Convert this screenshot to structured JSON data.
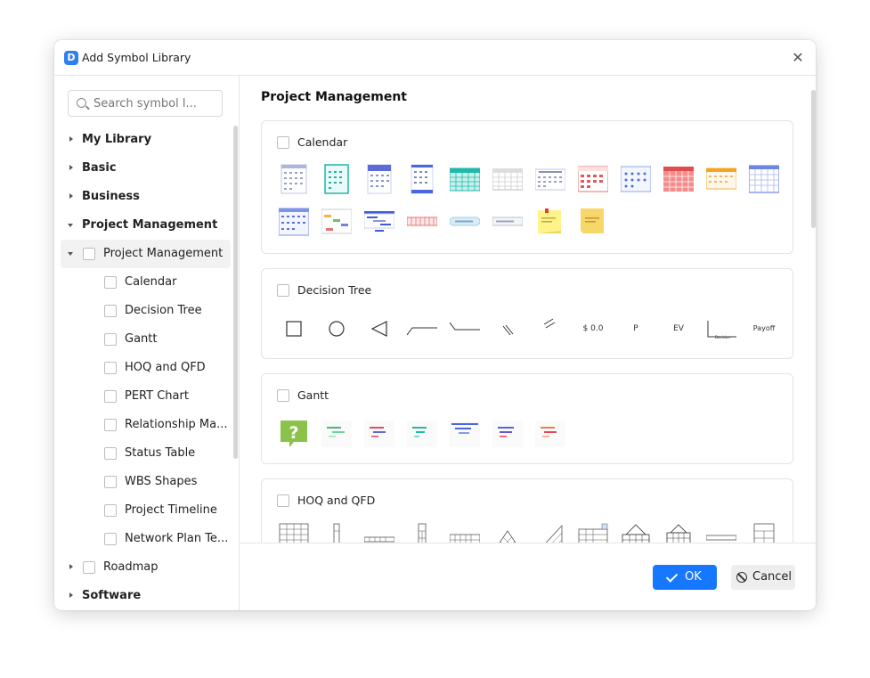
{
  "window": {
    "title": "Add Symbol Library",
    "app_icon": "app-logo-icon",
    "close_icon": "close-icon"
  },
  "search": {
    "placeholder": "Search symbol l..."
  },
  "tree": {
    "top_items": [
      {
        "label": "My Library",
        "expanded": false
      },
      {
        "label": "Basic",
        "expanded": false
      },
      {
        "label": "Business",
        "expanded": false
      },
      {
        "label": "Project Management",
        "expanded": true
      }
    ],
    "group": {
      "label": "Project Management",
      "expanded": true,
      "checked": false
    },
    "children": [
      {
        "label": "Calendar",
        "checked": false
      },
      {
        "label": "Decision Tree",
        "checked": false
      },
      {
        "label": "Gantt",
        "checked": false
      },
      {
        "label": "HOQ and QFD",
        "checked": false
      },
      {
        "label": "PERT Chart",
        "checked": false
      },
      {
        "label": "Relationship Ma...",
        "checked": false
      },
      {
        "label": "Status Table",
        "checked": false
      },
      {
        "label": "WBS Shapes",
        "checked": false
      },
      {
        "label": "Project Timeline",
        "checked": false
      },
      {
        "label": "Network Plan Te...",
        "checked": false
      }
    ],
    "roadmap": {
      "label": "Roadmap",
      "expanded": false,
      "checked": false
    },
    "software": {
      "label": "Software",
      "expanded": false
    }
  },
  "main": {
    "section_title": "Project Management",
    "cards": [
      {
        "title": "Calendar",
        "checked": false
      },
      {
        "title": "Decision Tree",
        "checked": false,
        "symbol_texts": [
          "$ 0.0",
          "P",
          "EV",
          "Decision",
          "Payoff"
        ]
      },
      {
        "title": "Gantt",
        "checked": false
      },
      {
        "title": "HOQ and QFD",
        "checked": false
      }
    ]
  },
  "footer": {
    "ok_label": "OK",
    "cancel_label": "Cancel"
  },
  "colors": {
    "accent": "#1677ff",
    "app_icon_bg": "#2f80ed",
    "gantt_help": "#8bc34a"
  }
}
